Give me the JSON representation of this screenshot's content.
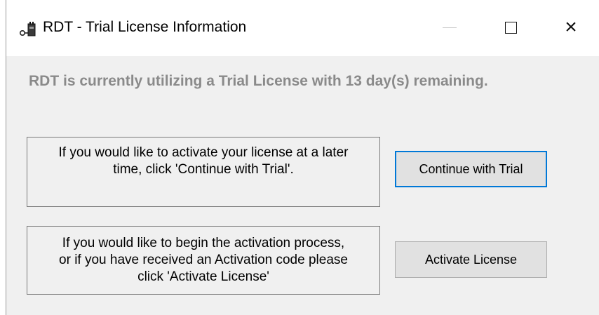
{
  "window": {
    "title": "RDT - Trial License Information",
    "icon": "key-plug-icon",
    "controls": {
      "minimize": "minimize-icon",
      "maximize": "maximize-icon",
      "close": "close-icon",
      "close_glyph": "×"
    }
  },
  "headline": "RDT is currently utilizing a Trial License with 13 day(s) remaining.",
  "sections": [
    {
      "message_lines": [
        "If you would like to activate your license at a later",
        "time, click 'Continue with Trial'."
      ],
      "button_label": "Continue with Trial"
    },
    {
      "message_lines": [
        "If you would like to begin the activation process,",
        "or if you have received an Activation code please",
        "click 'Activate License'"
      ],
      "button_label": "Activate License"
    }
  ],
  "colors": {
    "headline": "#8a8a8a",
    "window_bg": "#f0f0f0",
    "primary_button_border": "#0078d7"
  }
}
